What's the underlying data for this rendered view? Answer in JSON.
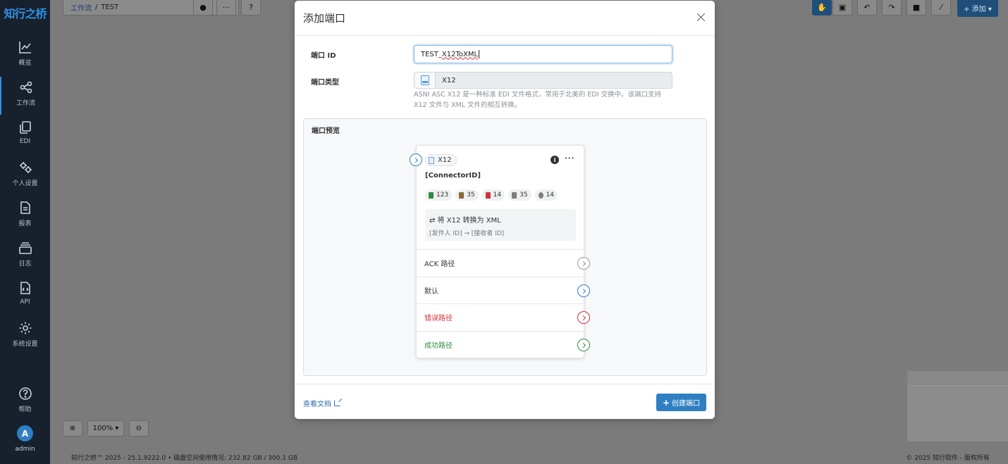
{
  "brand": "知行之桥",
  "sidebar": {
    "items": [
      {
        "label": "概览",
        "icon": "chart-line-icon"
      },
      {
        "label": "工作流",
        "icon": "share-nodes-icon",
        "active": true
      },
      {
        "label": "EDI",
        "icon": "copy-icon"
      },
      {
        "label": "个人设置",
        "icon": "gears-icon"
      },
      {
        "label": "报表",
        "icon": "file-lines-icon"
      },
      {
        "label": "日志",
        "icon": "layers-icon"
      },
      {
        "label": "API",
        "icon": "file-code-icon"
      },
      {
        "label": "系统设置",
        "icon": "gear-icon"
      }
    ],
    "help_label": "帮助",
    "avatar_letter": "A",
    "user_label": "admin"
  },
  "topbar": {
    "breadcrumb_root": "工作流",
    "breadcrumb_sep": "/",
    "breadcrumb_current": "TEST",
    "add_label": "+ 添加 ▾"
  },
  "zoom": {
    "level": "100% ▾"
  },
  "footer": {
    "left": "知行之桥™ 2025 - 25.1.9222.0  •  磁盘空间使用情况:  232.82 GB / 300.1 GB",
    "right": "© 2025 知行软件 - 版权所有"
  },
  "modal": {
    "title": "添加端口",
    "id_label": "端口 ID",
    "id_value_prefix": "TEST_",
    "id_value_misspelled": "X12ToXML",
    "type_label": "端口类型",
    "type_value": "X12",
    "type_description": "ASNI ASC X12 是一种标准 EDI 文件格式，常用于北美的 EDI 交换中。该端口支持 X12 文件与 XML 文件的相互转换。",
    "preview_label": "端口预览",
    "doc_link": "查看文档",
    "create_button": "创建端口"
  },
  "card": {
    "type": "X12",
    "connector_id": "[ConnectorID]",
    "stats": [
      {
        "value": "123",
        "color": "#2e8b3e"
      },
      {
        "value": "35",
        "color": "#8a6a3a"
      },
      {
        "value": "14",
        "color": "#d0313b"
      },
      {
        "value": "35",
        "color": "#7d7d7d"
      },
      {
        "value": "14",
        "color": "#7d7d7d"
      }
    ],
    "convert_line": "⇄  将 X12 转换为 XML",
    "route_line": "[发件人 ID] → [接收者 ID]",
    "routes": [
      {
        "label": "ACK 路径",
        "color": "#333333",
        "port_color": "#999999"
      },
      {
        "label": "默认",
        "color": "#333333",
        "port_color": "#2f7fc2"
      },
      {
        "label": "错误路径",
        "color": "#d0313b",
        "port_color": "#d0313b"
      },
      {
        "label": "成功路径",
        "color": "#2e8b3e",
        "port_color": "#2e8b3e"
      }
    ]
  },
  "colors": {
    "accent": "#2f7fc2",
    "sidebar_bg": "#17212e"
  }
}
